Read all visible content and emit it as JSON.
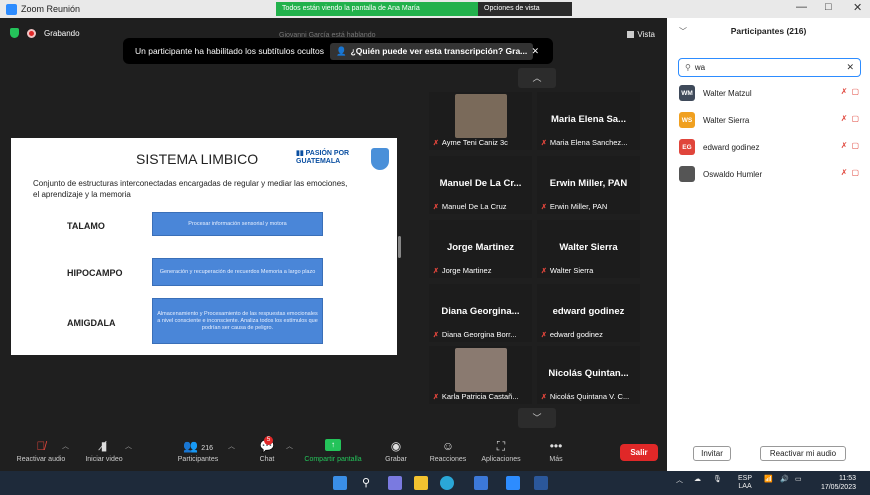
{
  "window": {
    "title": "Zoom Reunión",
    "green_notice": "Todos están viendo la pantalla de Ana María",
    "dark_notice": "Opciones de vista"
  },
  "meeting": {
    "recording_label": "Grabando",
    "view_label": "Vista",
    "banner_text": "Un participante ha habilitado los subtítulos ocultos",
    "banner_link": "¿Quién puede ver esta transcripción? Gra...",
    "speaker_ghost": "Giovanni García está hablando"
  },
  "slide": {
    "title": "SISTEMA LIMBICO",
    "logo_text": "PASIÓN POR\nGUATEMALA",
    "description": "Conjunto de estructuras interconectadas encargadas de regular y mediar las emociones, el aprendizaje y la memoria",
    "rows": [
      {
        "term": "TALAMO",
        "box": "Procesar información sensorial y motora"
      },
      {
        "term": "HIPOCAMPO",
        "box": "Generación y recuperación de recuerdos Memoria a largo plazo"
      },
      {
        "term": "AMIGDALA",
        "box": "Almacenamiento y Procesamiento de las respuestas emocionales a nivel consciente e inconsciente. Analiza todos los estímulos que podrían ser causa de peligro."
      }
    ]
  },
  "gallery": [
    {
      "name": "",
      "label": "Ayme Teni Caniz 3c",
      "photo": "#7a6a5a"
    },
    {
      "name": "Maria  Elena Sa...",
      "label": "Maria  Elena Sanchez..."
    },
    {
      "name": "Manuel De La Cr...",
      "label": "Manuel De La Cruz"
    },
    {
      "name": "Erwin Miller, PAN",
      "label": "Erwin Miller, PAN"
    },
    {
      "name": "Jorge Martinez",
      "label": "Jorge Martinez"
    },
    {
      "name": "Walter Sierra",
      "label": "Walter Sierra"
    },
    {
      "name": "Diana  Georgina...",
      "label": "Diana Georgina Borr..."
    },
    {
      "name": "edward godinez",
      "label": "edward godinez"
    },
    {
      "name": "",
      "label": "Karla Patricia Castañ...",
      "photo": "#8a7a70"
    },
    {
      "name": "Nicolás  Quintan...",
      "label": "Nicolás Quintana V. C..."
    }
  ],
  "toolbar": {
    "audio": "Reactivar audio",
    "video": "Iniciar video",
    "participants": "Participantes",
    "participants_count": "216",
    "chat": "Chat",
    "chat_badge": "5",
    "share": "Compartir pantalla",
    "record": "Grabar",
    "reactions": "Reacciones",
    "apps": "Aplicaciones",
    "more": "Más",
    "leave": "Salir"
  },
  "panel": {
    "header": "Participantes (216)",
    "search_value": "wa",
    "participants": [
      {
        "initials": "WM",
        "name": "Walter  Matzul",
        "color": "#3f4a5a"
      },
      {
        "initials": "WS",
        "name": "Walter Sierra",
        "color": "#f0a020"
      },
      {
        "initials": "EG",
        "name": "edward godinez",
        "color": "#e0453b"
      },
      {
        "initials": "",
        "name": "Oswaldo Humler",
        "color": "#555555"
      }
    ],
    "invite": "Invitar",
    "unmute": "Reactivar mi audio"
  },
  "taskbar": {
    "lang": "ESP",
    "lang2": "LAA",
    "time": "11:53",
    "date": "17/05/2023"
  }
}
